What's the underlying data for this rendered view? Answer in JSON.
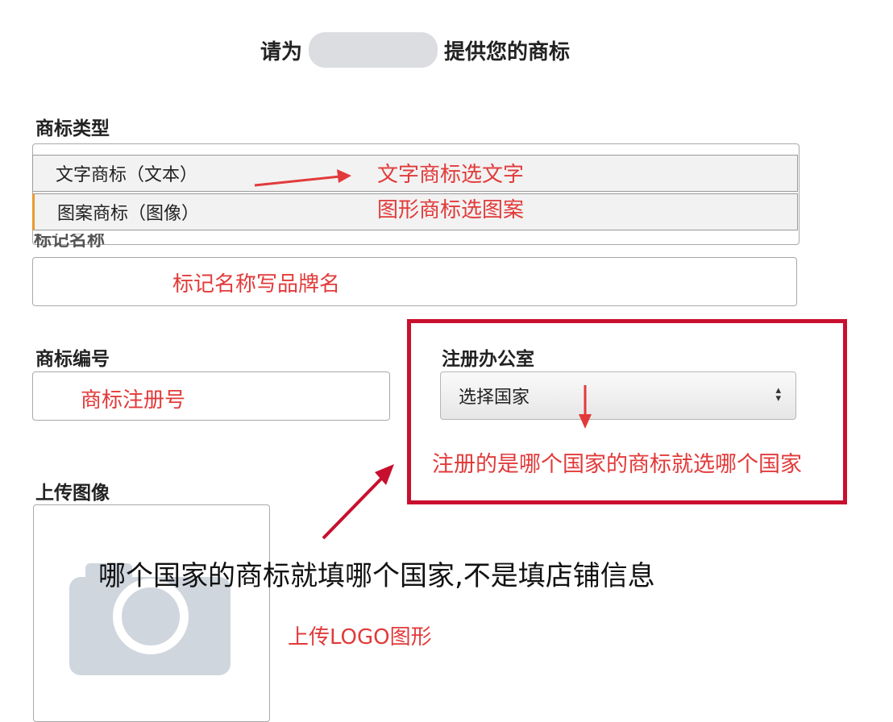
{
  "header": {
    "title_prefix": "请为",
    "title_suffix": "提供您的商标"
  },
  "form": {
    "trademark_type_label": "商标类型",
    "trademark_type_options": [
      "文字商标（文本）",
      "图案商标（图像）"
    ],
    "mark_name_label_partial": "标记名称",
    "trademark_number_label": "商标编号",
    "registration_office_label": "注册办公室",
    "registration_office_selected": "选择国家",
    "upload_label": "上传图像"
  },
  "annotations": {
    "type_note_line1": "文字商标选文字",
    "type_note_line2": "图形商标选图案",
    "mark_name_note": "标记名称写品牌名",
    "trademark_number_note": "商标注册号",
    "office_note": "注册的是哪个国家的商标就选哪个国家",
    "main_note": "哪个国家的商标就填哪个国家,不是填店铺信息",
    "upload_note": "上传LOGO图形"
  },
  "colors": {
    "annotation_red": "#e23a3a",
    "box_red": "#c8102e",
    "placeholder_gray": "#d0d6de"
  },
  "icons": {
    "upload_placeholder": "camera-icon",
    "select_arrow": "up-down-caret-icon"
  }
}
